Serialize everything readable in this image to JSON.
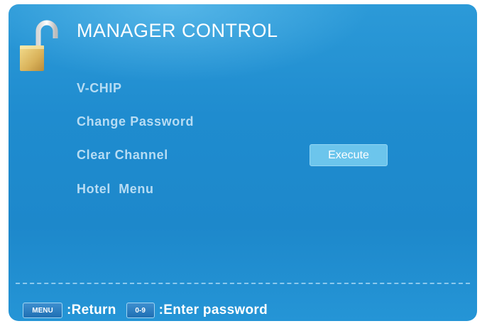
{
  "header": {
    "title": "MANAGER CONTROL",
    "icon": "padlock-open-icon"
  },
  "menu": {
    "items": [
      {
        "label": "V-CHIP"
      },
      {
        "label": "Change Password"
      },
      {
        "label": "Clear Channel"
      },
      {
        "label": "Hotel  Menu"
      }
    ],
    "execute_label": "Execute"
  },
  "footer": {
    "menu_key": "MENU",
    "menu_hint": ":Return",
    "digits_key": "0-9",
    "digits_hint": ":Enter password"
  },
  "colors": {
    "background": "#1f8ccf",
    "menu_text": "#b7dcf3",
    "execute_button": "#6cc5ec"
  }
}
